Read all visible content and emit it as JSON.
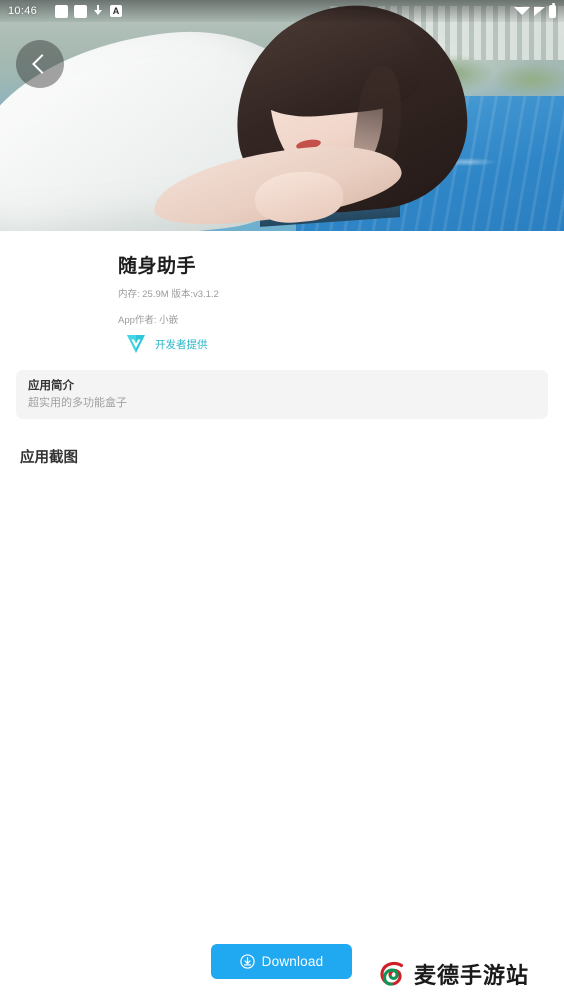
{
  "statusbar": {
    "time": "10:46",
    "left_icons": [
      "app-placeholder-icon",
      "app-placeholder-icon",
      "download-icon",
      "letter-a-icon"
    ],
    "right_icons": [
      "wifi-icon",
      "signal-icon",
      "battery-icon"
    ]
  },
  "hero": {
    "back_button": "back-arrow-icon",
    "image_description": "poolside portrait"
  },
  "app": {
    "title": "随身助手",
    "meta": "内存: 25.9M 版本:v3.1.2",
    "author": "App作者: 小嵌",
    "developer_badge": {
      "label": "开发者提供",
      "icon": "verified-diamond-icon",
      "color": "#27b7c9"
    }
  },
  "description": {
    "heading": "应用简介",
    "text": "超实用的多功能盒子"
  },
  "screenshots": {
    "heading": "应用截图",
    "items": []
  },
  "footer": {
    "download": {
      "label": "Download",
      "icon": "download-circle-icon",
      "color": "#20a8f0"
    },
    "watermark": {
      "text": "麦德手游站",
      "logo": "spiral-logo-icon"
    }
  }
}
